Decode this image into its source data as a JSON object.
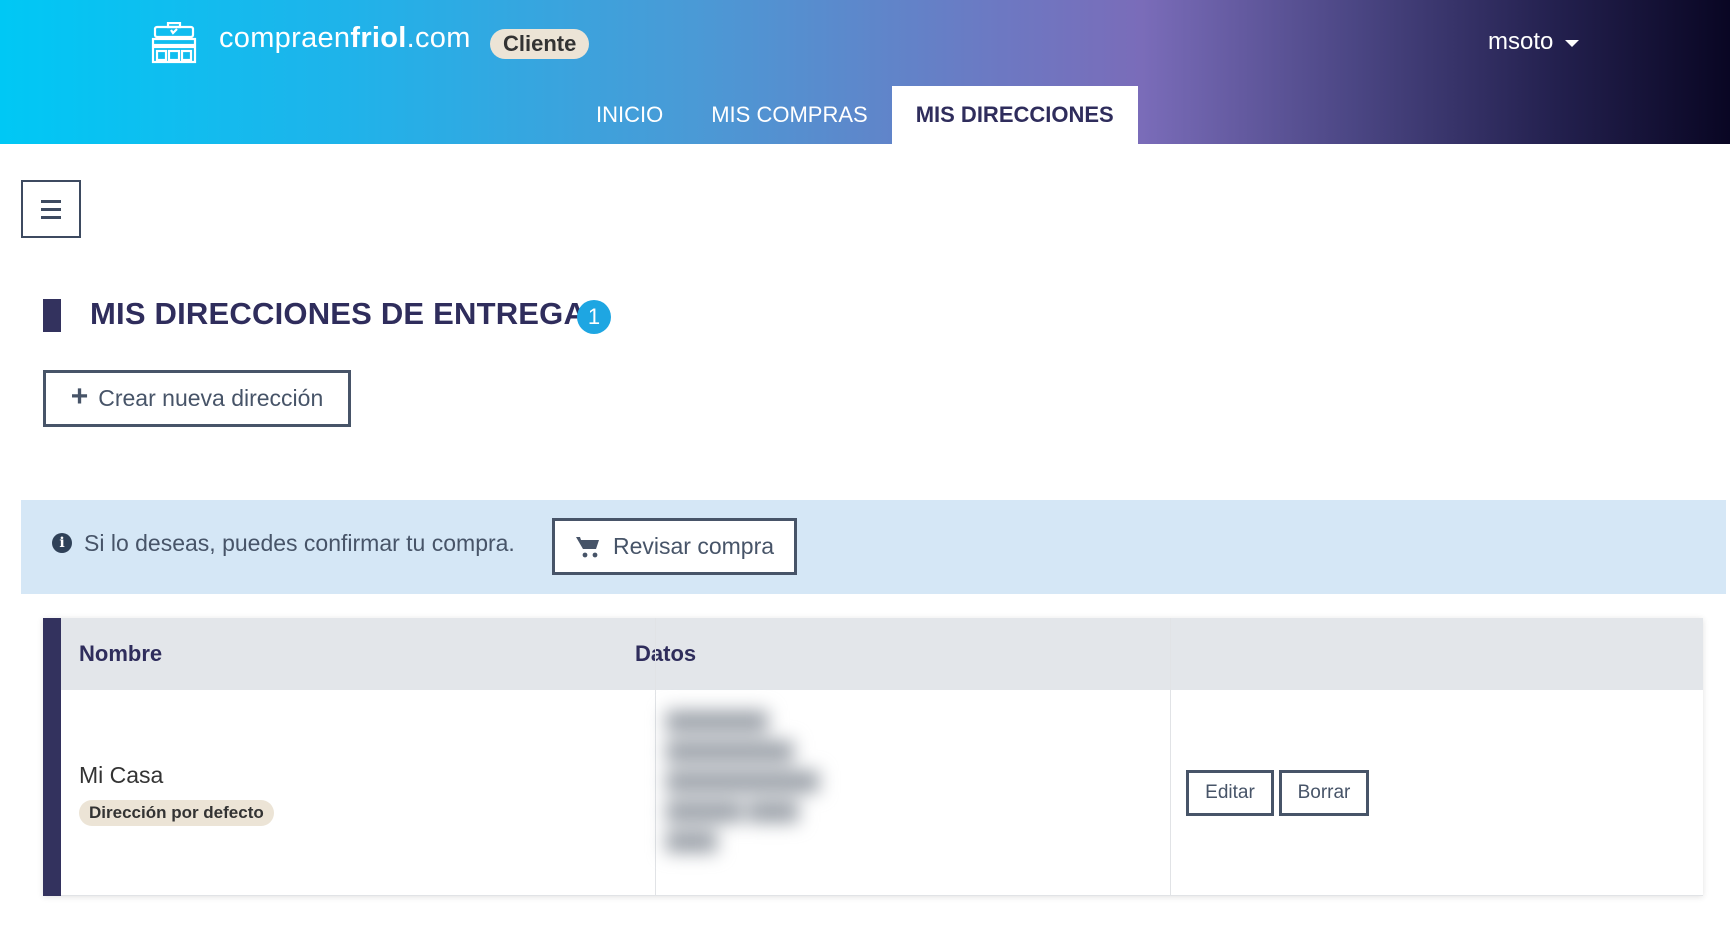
{
  "header": {
    "brand_prefix": "compraen",
    "brand_bold": "friol",
    "brand_suffix": ".com",
    "brand_badge": "Cliente",
    "user": "msoto",
    "nav": [
      {
        "label": "INICIO",
        "active": false
      },
      {
        "label": "MIS COMPRAS",
        "active": false
      },
      {
        "label": "MIS DIRECCIONES",
        "active": true
      }
    ]
  },
  "page": {
    "title": "MIS DIRECCIONES DE ENTREGA",
    "count": "1",
    "create_button": "Crear nueva dirección"
  },
  "alert": {
    "text": "Si lo deseas, puedes confirmar tu compra.",
    "button": "Revisar compra"
  },
  "table": {
    "headers": [
      "Nombre",
      "Datos",
      ""
    ],
    "rows": [
      {
        "name": "Mi Casa",
        "badge": "Dirección por defecto",
        "edit": "Editar",
        "delete": "Borrar"
      }
    ]
  },
  "colors": {
    "accent": "#33325e",
    "badge_blue": "#1ea6e2",
    "alert_bg": "#d5e7f6",
    "button_border": "#475468"
  },
  "icons": [
    "store-icon",
    "caret-down-icon",
    "hamburger-icon",
    "plus-icon",
    "info-icon",
    "cart-icon"
  ]
}
